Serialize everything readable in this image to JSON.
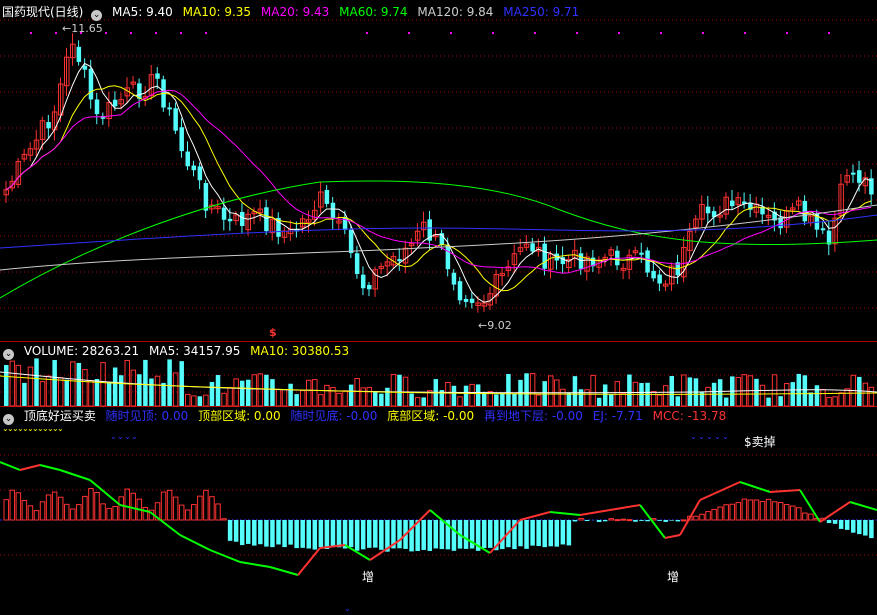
{
  "main_panel": {
    "title": "国药现代(日线)",
    "indicators": [
      {
        "text": "MA5: 9.40",
        "color": "#ffffff"
      },
      {
        "text": "MA10: 9.35",
        "color": "#ffff00"
      },
      {
        "text": "MA20: 9.43",
        "color": "#ff00ff"
      },
      {
        "text": "MA60: 9.74",
        "color": "#00ff00"
      },
      {
        "text": "MA120: 9.84",
        "color": "#cccccc"
      },
      {
        "text": "MA250: 9.71",
        "color": "#0000ff"
      }
    ],
    "high_label": "11.65",
    "low_label": "9.02",
    "signal_mark": "$",
    "colors": {
      "up": "#ff3232",
      "down": "#54fcfc",
      "grid": "#a00000"
    }
  },
  "volume_panel": {
    "title_indicators": [
      {
        "text": "VOLUME: 28263.21",
        "color": "#ffffff"
      },
      {
        "text": "MA5: 34157.95",
        "color": "#ffffff"
      },
      {
        "text": "MA10: 30380.53",
        "color": "#ffff00"
      }
    ]
  },
  "indicator_panel": {
    "title": "顶底好运买卖",
    "indicators": [
      {
        "text": "随时见顶: 0.00",
        "color": "#3030ff"
      },
      {
        "text": "顶部区域: 0.00",
        "color": "#ffff00"
      },
      {
        "text": "随时见底: -0.00",
        "color": "#3030ff"
      },
      {
        "text": "底部区域: -0.00",
        "color": "#ffff00"
      },
      {
        "text": "再到地下层: -0.00",
        "color": "#3030ff"
      },
      {
        "text": "EJ: -7.71",
        "color": "#3030ff"
      },
      {
        "text": "MCC: -13.78",
        "color": "#ff3232"
      }
    ],
    "sell_label": "$卖掉",
    "increase_label": "增"
  }
}
